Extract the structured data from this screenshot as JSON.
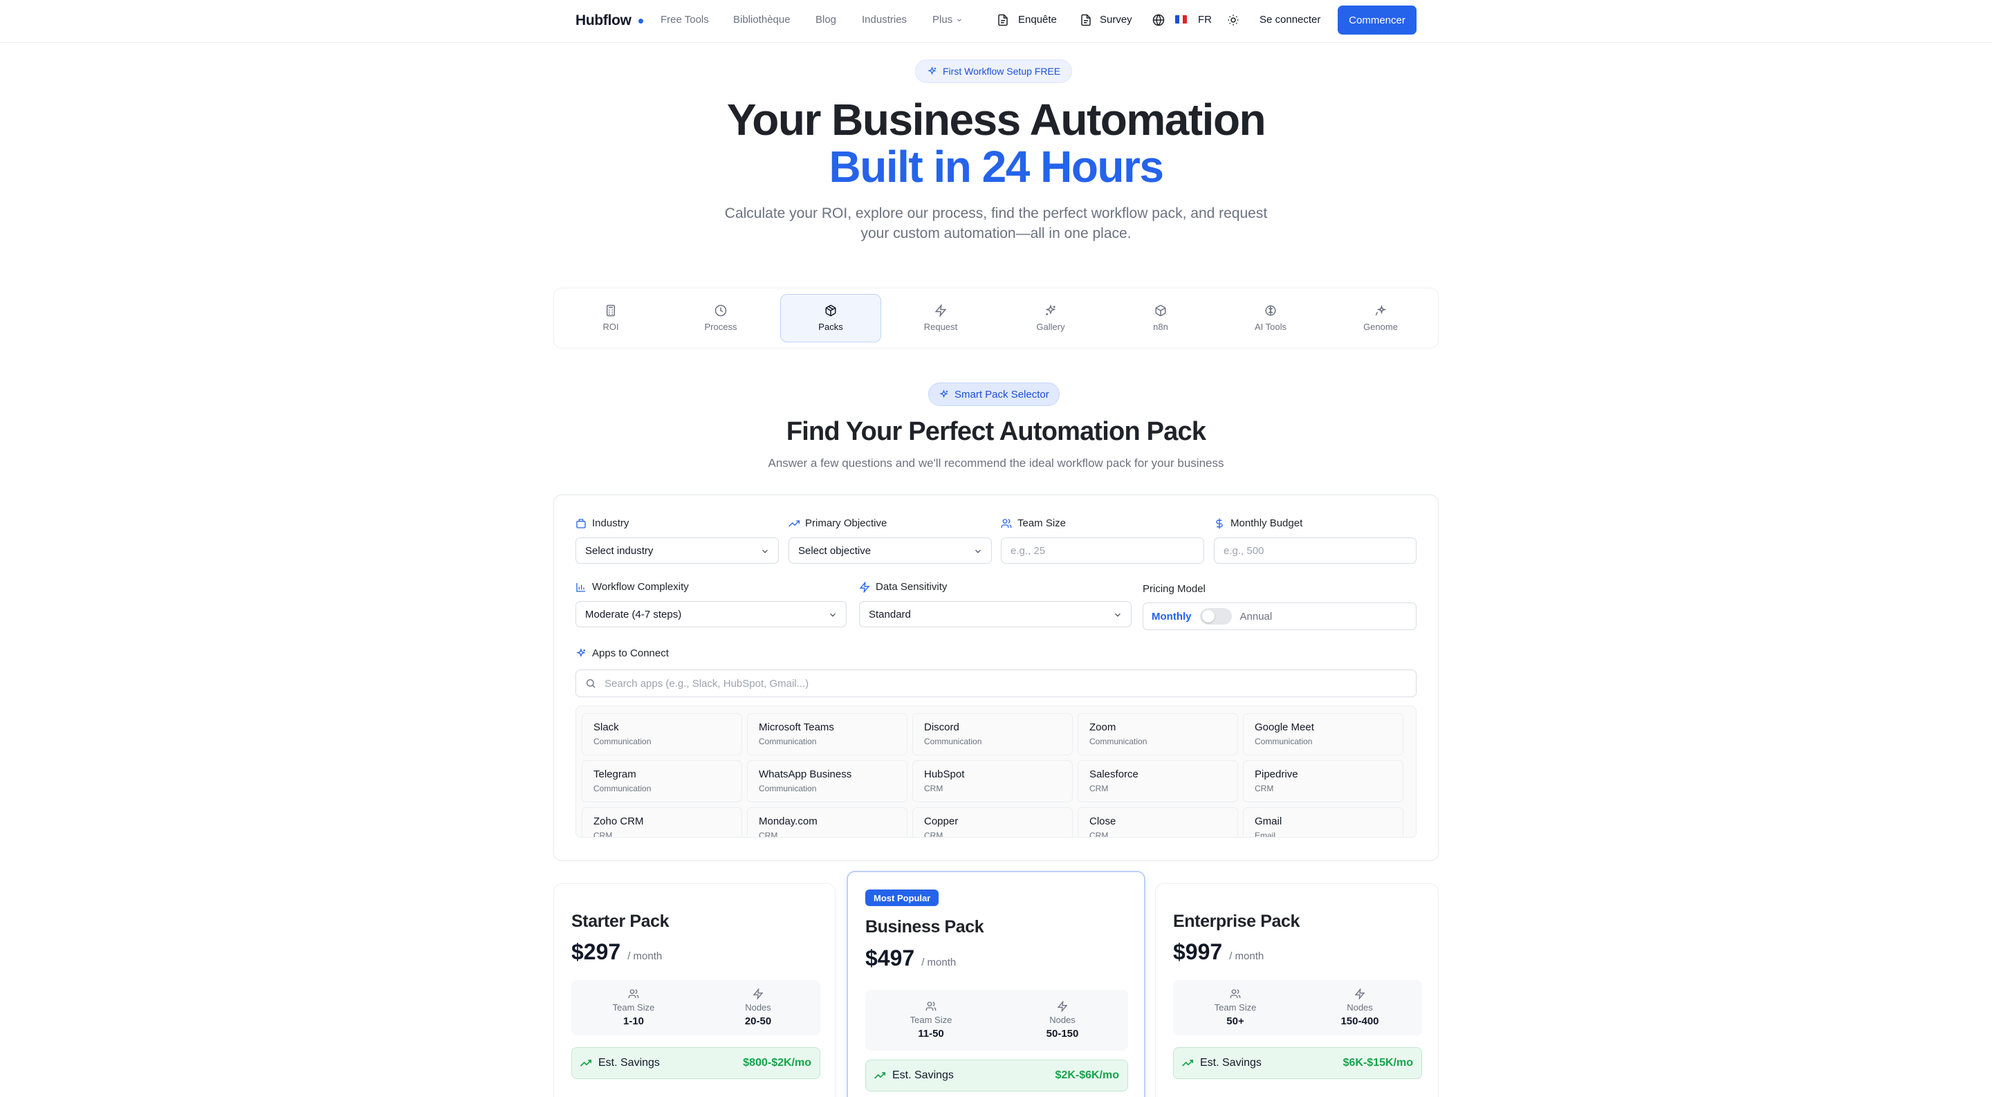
{
  "nav": {
    "brand": "Hubflow",
    "links": [
      "Free Tools",
      "Bibliothèque",
      "Blog",
      "Industries",
      "Plus"
    ],
    "enquete": "Enquête",
    "survey": "Survey",
    "lang": "FR",
    "signin": "Se connecter",
    "cta": "Commencer"
  },
  "hero": {
    "badge": "First Workflow Setup FREE",
    "title_line1": "Your Business Automation",
    "title_line2": "Built in 24 Hours",
    "subtitle": "Calculate your ROI, explore our process, find the perfect workflow pack, and request your custom automation—all in one place."
  },
  "tabs": [
    {
      "label": "ROI",
      "icon": "calculator-icon"
    },
    {
      "label": "Process",
      "icon": "clock-icon"
    },
    {
      "label": "Packs",
      "icon": "package-icon"
    },
    {
      "label": "Request",
      "icon": "zap-icon"
    },
    {
      "label": "Gallery",
      "icon": "sparkles-icon"
    },
    {
      "label": "n8n",
      "icon": "box-icon"
    },
    {
      "label": "AI Tools",
      "icon": "brain-icon"
    },
    {
      "label": "Genome",
      "icon": "sparkle-icon"
    }
  ],
  "active_tab": "Packs",
  "section": {
    "badge": "Smart Pack Selector",
    "title": "Find Your Perfect Automation Pack",
    "subtitle": "Answer a few questions and we'll recommend the ideal workflow pack for your business"
  },
  "form": {
    "industry": {
      "label": "Industry",
      "value": "Select industry"
    },
    "objective": {
      "label": "Primary Objective",
      "value": "Select objective"
    },
    "team_size": {
      "label": "Team Size",
      "placeholder": "e.g., 25"
    },
    "budget": {
      "label": "Monthly Budget",
      "placeholder": "e.g., 500"
    },
    "complexity": {
      "label": "Workflow Complexity",
      "value": "Moderate (4-7 steps)"
    },
    "sensitivity": {
      "label": "Data Sensitivity",
      "value": "Standard"
    },
    "pricing_model": {
      "label": "Pricing Model",
      "monthly": "Monthly",
      "annual": "Annual",
      "selected": "Monthly"
    },
    "apps": {
      "label": "Apps to Connect",
      "search_placeholder": "Search apps (e.g., Slack, HubSpot, Gmail...)",
      "items": [
        {
          "name": "Slack",
          "category": "Communication"
        },
        {
          "name": "Microsoft Teams",
          "category": "Communication"
        },
        {
          "name": "Discord",
          "category": "Communication"
        },
        {
          "name": "Zoom",
          "category": "Communication"
        },
        {
          "name": "Google Meet",
          "category": "Communication"
        },
        {
          "name": "Telegram",
          "category": "Communication"
        },
        {
          "name": "WhatsApp Business",
          "category": "Communication"
        },
        {
          "name": "HubSpot",
          "category": "CRM"
        },
        {
          "name": "Salesforce",
          "category": "CRM"
        },
        {
          "name": "Pipedrive",
          "category": "CRM"
        },
        {
          "name": "Zoho CRM",
          "category": "CRM"
        },
        {
          "name": "Monday.com",
          "category": "CRM"
        },
        {
          "name": "Copper",
          "category": "CRM"
        },
        {
          "name": "Close",
          "category": "CRM"
        },
        {
          "name": "Gmail",
          "category": "Email"
        }
      ]
    }
  },
  "packs": [
    {
      "name": "Starter Pack",
      "price": "$297",
      "period": "/ month",
      "team_label": "Team Size",
      "team": "1-10",
      "nodes_label": "Nodes",
      "nodes": "20-50",
      "savings_label": "Est. Savings",
      "savings": "$800-$2K/mo",
      "badge": ""
    },
    {
      "name": "Business Pack",
      "price": "$497",
      "period": "/ month",
      "team_label": "Team Size",
      "team": "11-50",
      "nodes_label": "Nodes",
      "nodes": "50-150",
      "savings_label": "Est. Savings",
      "savings": "$2K-$6K/mo",
      "badge": "Most Popular"
    },
    {
      "name": "Enterprise Pack",
      "price": "$997",
      "period": "/ month",
      "team_label": "Team Size",
      "team": "50+",
      "nodes_label": "Nodes",
      "nodes": "150-400",
      "savings_label": "Est. Savings",
      "savings": "$6K-$15K/mo",
      "badge": ""
    }
  ],
  "colors": {
    "accent": "#2563eb",
    "savings_green": "#16a34a",
    "flag": [
      "#1d4ed8",
      "#ffffff",
      "#dc2626"
    ]
  }
}
